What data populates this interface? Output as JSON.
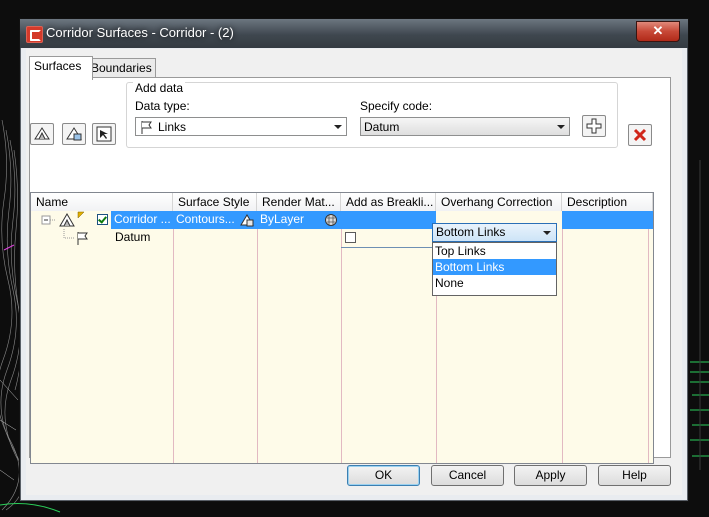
{
  "window": {
    "title": "Corridor Surfaces - Corridor - (2)",
    "close_glyph": "✕"
  },
  "tabs": [
    {
      "label": "Surfaces",
      "active": true
    },
    {
      "label": "Boundaries",
      "active": false
    }
  ],
  "add_data": {
    "group_label": "Add data",
    "data_type_label": "Data type:",
    "data_type_value": "Links",
    "specify_code_label": "Specify code:",
    "specify_code_value": "Datum"
  },
  "table": {
    "columns": [
      "Name",
      "Surface Style",
      "Render Mat...",
      "Add as Breakli...",
      "Overhang Correction",
      "Description"
    ],
    "rows": [
      {
        "name": "Corridor ...",
        "surface_style": "Contours...",
        "render_material": "ByLayer",
        "overhang_correction": "Bottom Links",
        "checked": true,
        "selected": true
      },
      {
        "name": "Datum",
        "add_as_breakline": false,
        "selected": false
      }
    ]
  },
  "overhang_dropdown": {
    "selected": "Bottom Links",
    "options": [
      "Top Links",
      "Bottom Links",
      "None"
    ],
    "highlighted": "Bottom Links"
  },
  "buttons": {
    "ok": "OK",
    "cancel": "Cancel",
    "apply": "Apply",
    "help": "Help"
  },
  "colors": {
    "selection": "#3399ff",
    "table_bg": "#fefbe9",
    "delete_red": "#d0261a"
  }
}
